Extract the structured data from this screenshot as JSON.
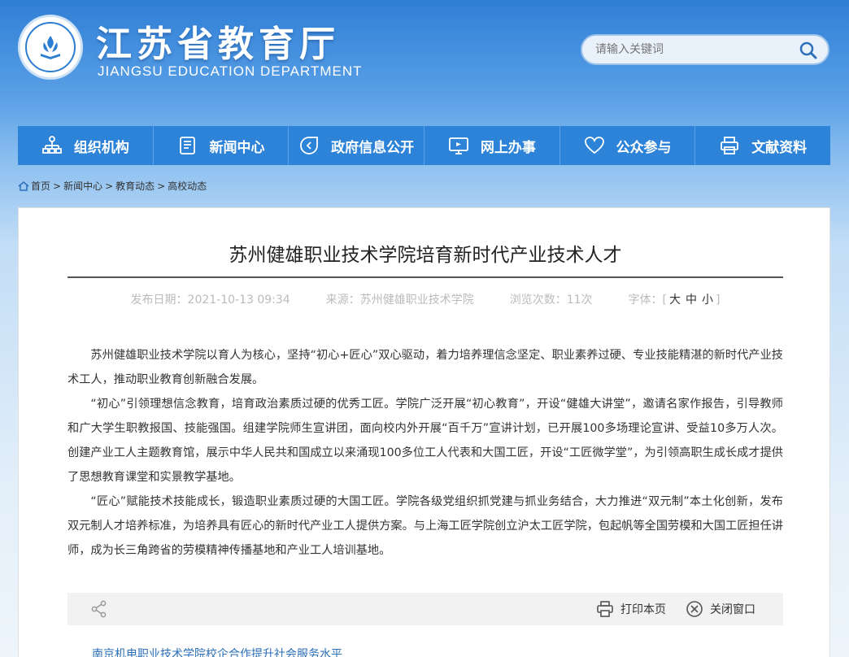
{
  "header": {
    "title": "江苏省教育厅",
    "subtitle": "JIANGSU EDUCATION DEPARTMENT",
    "search_placeholder": "请输入关键词"
  },
  "nav": [
    {
      "label": "组织机构",
      "icon": "org-chart-icon"
    },
    {
      "label": "新闻中心",
      "icon": "news-icon"
    },
    {
      "label": "政府信息公开",
      "icon": "info-open-icon"
    },
    {
      "label": "网上办事",
      "icon": "online-service-icon"
    },
    {
      "label": "公众参与",
      "icon": "heart-icon"
    },
    {
      "label": "文献资料",
      "icon": "printer-icon"
    }
  ],
  "breadcrumb": [
    "首页",
    "新闻中心",
    "教育动态",
    "高校动态"
  ],
  "article": {
    "title": "苏州健雄职业技术学院培育新时代产业技术人才",
    "publish_date": "发布日期：2021-10-13 09:34",
    "source": "来源：苏州健雄职业技术学院",
    "views": "浏览次数：11次",
    "font_label": "字体：",
    "font_large": "大",
    "font_medium": "中",
    "font_small": "小",
    "paragraphs": [
      "苏州健雄职业技术学院以育人为核心，坚持“初心+匠心”双心驱动，着力培养理信念坚定、职业素养过硬、专业技能精湛的新时代产业技术工人，推动职业教育创新融合发展。",
      "“初心”引领理想信念教育，培育政治素质过硬的优秀工匠。学院广泛开展“初心教育”，开设“健雄大讲堂”，邀请名家作报告，引导教师和广大学生职教报国、技能强国。组建学院师生宣讲团，面向校内外开展“百千万”宣讲计划，已开展100多场理论宣讲、受益10多万人次。创建产业工人主题教育馆，展示中华人民共和国成立以来涌现100多位工人代表和大国工匠，开设“工匠微学堂”，为引领高职生成长成才提供了思想教育课堂和实景教学基地。",
      "“匠心”赋能技术技能成长，锻造职业素质过硬的大国工匠。学院各级党组织抓党建与抓业务结合，大力推进“双元制”本土化创新，发布双元制人才培养标准，为培养具有匠心的新时代产业工人提供方案。与上海工匠学院创立沪太工匠学院，包起帆等全国劳模和大国工匠担任讲师，成为长三角跨省的劳模精神传播基地和产业工人培训基地。"
    ],
    "print_label": "打印本页",
    "close_label": "关闭窗口"
  },
  "related_link": "南京机电职业技术学院校企合作提升社会服务水平",
  "colors": {
    "nav_bg": "#2c83d8",
    "link": "#2d6fb8"
  }
}
